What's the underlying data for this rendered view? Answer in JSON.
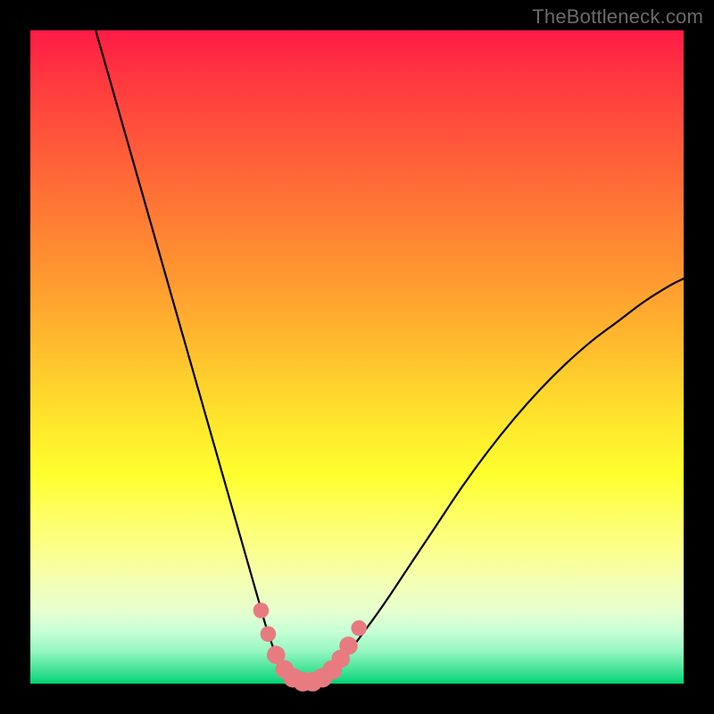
{
  "watermark": "TheBottleneck.com",
  "colors": {
    "frame": "#000000",
    "curve": "#000000",
    "marker_fill": "#e77b7f",
    "marker_stroke": "#da6a6e"
  },
  "chart_data": {
    "type": "line",
    "title": "",
    "xlabel": "",
    "ylabel": "",
    "xlim": [
      0,
      100
    ],
    "ylim": [
      0,
      100
    ],
    "grid": false,
    "legend": false,
    "series": [
      {
        "name": "bottleneck-curve",
        "x": [
          10,
          12,
          14,
          16,
          18,
          20,
          22,
          24,
          26,
          28,
          30,
          31,
          32,
          33,
          34,
          35,
          36,
          37,
          38,
          39,
          40,
          41,
          42,
          43,
          44,
          46,
          48,
          50,
          54,
          58,
          62,
          66,
          70,
          74,
          78,
          82,
          86,
          90,
          94,
          98,
          100
        ],
        "y": [
          100,
          93,
          86,
          79,
          72,
          65,
          58,
          51,
          44,
          37,
          30,
          26.5,
          23,
          19.5,
          16,
          12.5,
          9,
          6,
          3.5,
          1.8,
          0.8,
          0.3,
          0.2,
          0.3,
          0.8,
          2.0,
          4.0,
          6.5,
          12,
          18,
          24,
          30,
          35.5,
          40.5,
          45,
          49,
          52.5,
          55.5,
          58.5,
          61,
          62
        ]
      }
    ],
    "markers": {
      "name": "highlighted-points",
      "points": [
        {
          "x": 35.3,
          "y": 11.2,
          "r": 1.2
        },
        {
          "x": 36.4,
          "y": 7.6,
          "r": 1.2
        },
        {
          "x": 37.6,
          "y": 4.4,
          "r": 1.4
        },
        {
          "x": 38.9,
          "y": 2.2,
          "r": 1.4
        },
        {
          "x": 40.2,
          "y": 0.9,
          "r": 1.5
        },
        {
          "x": 41.7,
          "y": 0.3,
          "r": 1.5
        },
        {
          "x": 43.2,
          "y": 0.3,
          "r": 1.5
        },
        {
          "x": 44.7,
          "y": 0.9,
          "r": 1.5
        },
        {
          "x": 46.2,
          "y": 2.1,
          "r": 1.5
        },
        {
          "x": 47.5,
          "y": 3.8,
          "r": 1.4
        },
        {
          "x": 48.7,
          "y": 5.8,
          "r": 1.4
        },
        {
          "x": 50.3,
          "y": 8.5,
          "r": 1.2
        }
      ]
    }
  }
}
